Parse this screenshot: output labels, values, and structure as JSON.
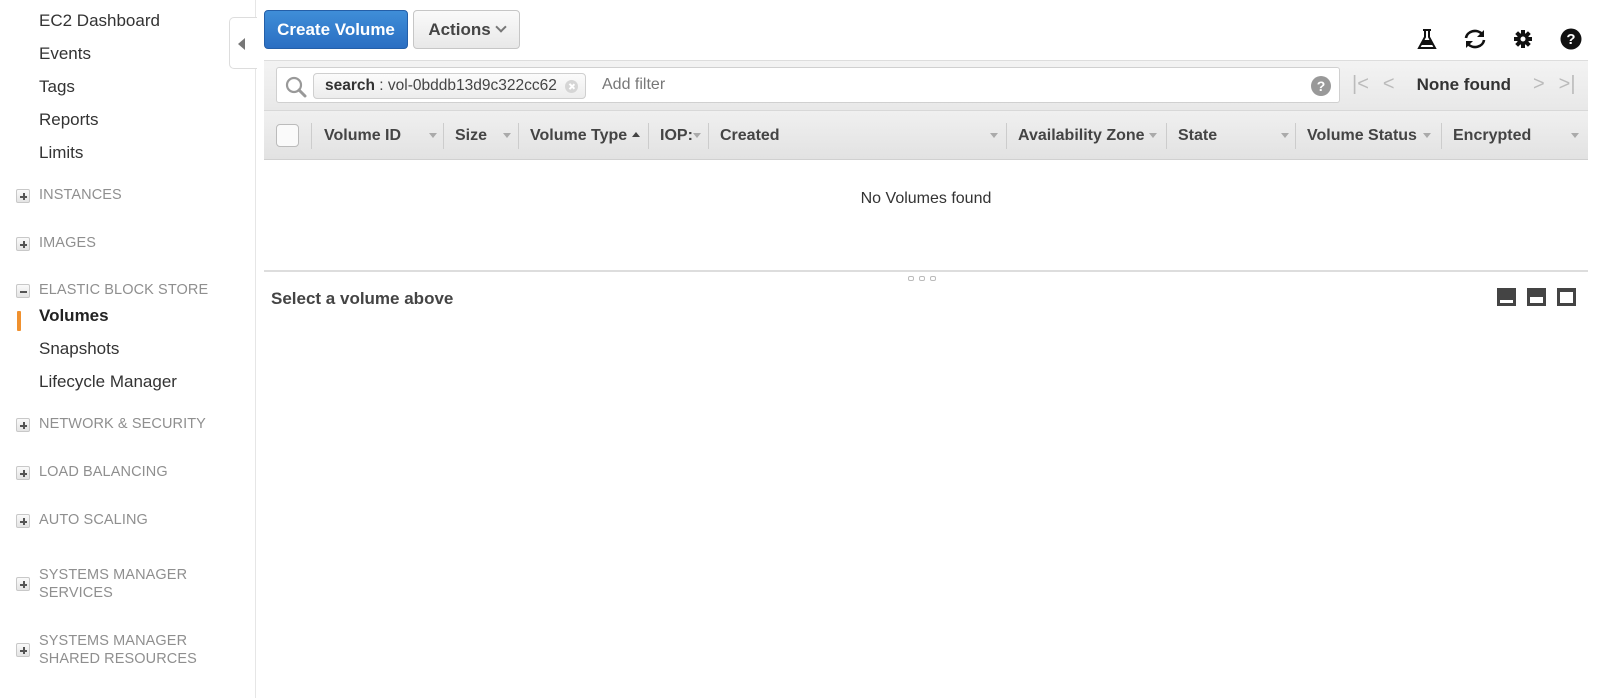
{
  "sidebar": {
    "items": [
      {
        "label": "EC2 Dashboard"
      },
      {
        "label": "Events"
      },
      {
        "label": "Tags"
      },
      {
        "label": "Reports"
      },
      {
        "label": "Limits"
      }
    ],
    "sections": [
      {
        "label": "INSTANCES",
        "expanded": false
      },
      {
        "label": "IMAGES",
        "expanded": false
      },
      {
        "label": "ELASTIC BLOCK STORE",
        "expanded": true,
        "items": [
          {
            "label": "Volumes",
            "active": true
          },
          {
            "label": "Snapshots"
          },
          {
            "label": "Lifecycle Manager"
          }
        ]
      },
      {
        "label": "NETWORK & SECURITY",
        "expanded": false
      },
      {
        "label": "LOAD BALANCING",
        "expanded": false
      },
      {
        "label": "AUTO SCALING",
        "expanded": false
      },
      {
        "label": "SYSTEMS MANAGER SERVICES",
        "expanded": false
      },
      {
        "label": "SYSTEMS MANAGER SHARED RESOURCES",
        "expanded": false
      }
    ],
    "accent_color": "#f0912f"
  },
  "toolbar": {
    "create_label": "Create Volume",
    "actions_label": "Actions",
    "primary_color": "#2f7bcf",
    "icons": [
      "flask-icon",
      "refresh-icon",
      "gear-icon",
      "help-icon"
    ]
  },
  "filter": {
    "token_key": "search",
    "token_sep": " : ",
    "token_value": "vol-0bddb13d9c322cc62",
    "placeholder": "Add filter",
    "help": "?"
  },
  "pager": {
    "first": "|<",
    "prev": "<",
    "status": "None found",
    "next": ">",
    "last": ">|"
  },
  "table": {
    "columns": [
      {
        "label": "Volume ID",
        "sort": "none"
      },
      {
        "label": "Size",
        "sort": "none"
      },
      {
        "label": "Volume Type",
        "sort": "asc"
      },
      {
        "label": "IOP:",
        "sort": "none"
      },
      {
        "label": "Created",
        "sort": "none"
      },
      {
        "label": "Availability Zone",
        "sort": "none"
      },
      {
        "label": "State",
        "sort": "none"
      },
      {
        "label": "Volume Status",
        "sort": "none"
      },
      {
        "label": "Encrypted",
        "sort": "none"
      }
    ],
    "rows": [],
    "empty_message": "No Volumes found"
  },
  "detail": {
    "title": "Select a volume above"
  }
}
